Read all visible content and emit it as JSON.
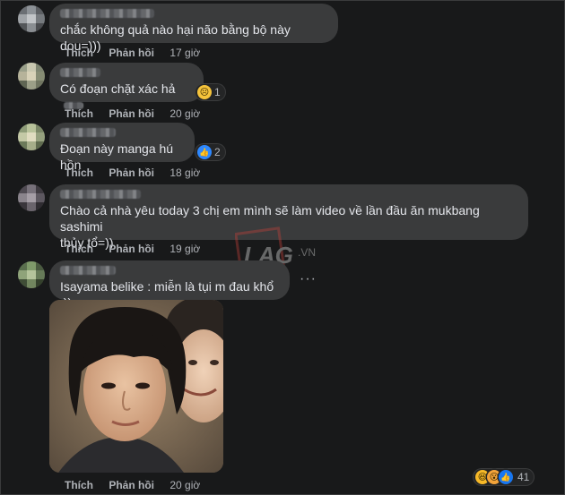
{
  "comments": [
    {
      "text": "chắc không quả nào hại não bằng bộ này dou=)))",
      "like": "Thích",
      "reply": "Phản hồi",
      "time": "17 giờ"
    },
    {
      "text": "Có đoạn chặt xác hả",
      "like": "Thích",
      "reply": "Phản hồi",
      "time": "20 giờ",
      "reaction": {
        "icon": "sad-reaction-icon",
        "count": "1"
      }
    },
    {
      "text": "Đoạn này manga hú hồn",
      "like": "Thích",
      "reply": "Phản hồi",
      "time": "18 giờ",
      "reaction": {
        "icon": "like-reaction-icon",
        "count": "2"
      }
    },
    {
      "text_line1": "Chào cả nhà yêu today 3 chị em mình sẽ làm video về lần đầu ăn mukbang sashimi",
      "text_line2": "thủy tổ=))",
      "like": "Thích",
      "reply": "Phản hồi",
      "time": "19 giờ"
    },
    {
      "text": "Isayama belike : miễn là tụi m đau khổ :))",
      "like": "Thích",
      "reply": "Phản hồi",
      "time": "20 giờ",
      "reaction": {
        "icons": [
          "haha-reaction-icon",
          "wow-reaction-icon",
          "like-reaction-icon"
        ],
        "count": "41"
      }
    }
  ],
  "watermark": "LAG.VN",
  "colors": {
    "background": "#18191a",
    "bubble": "#3a3b3c",
    "text": "#e4e6eb",
    "secondary": "#b0b3b8",
    "like_blue": "#2d88ff"
  }
}
